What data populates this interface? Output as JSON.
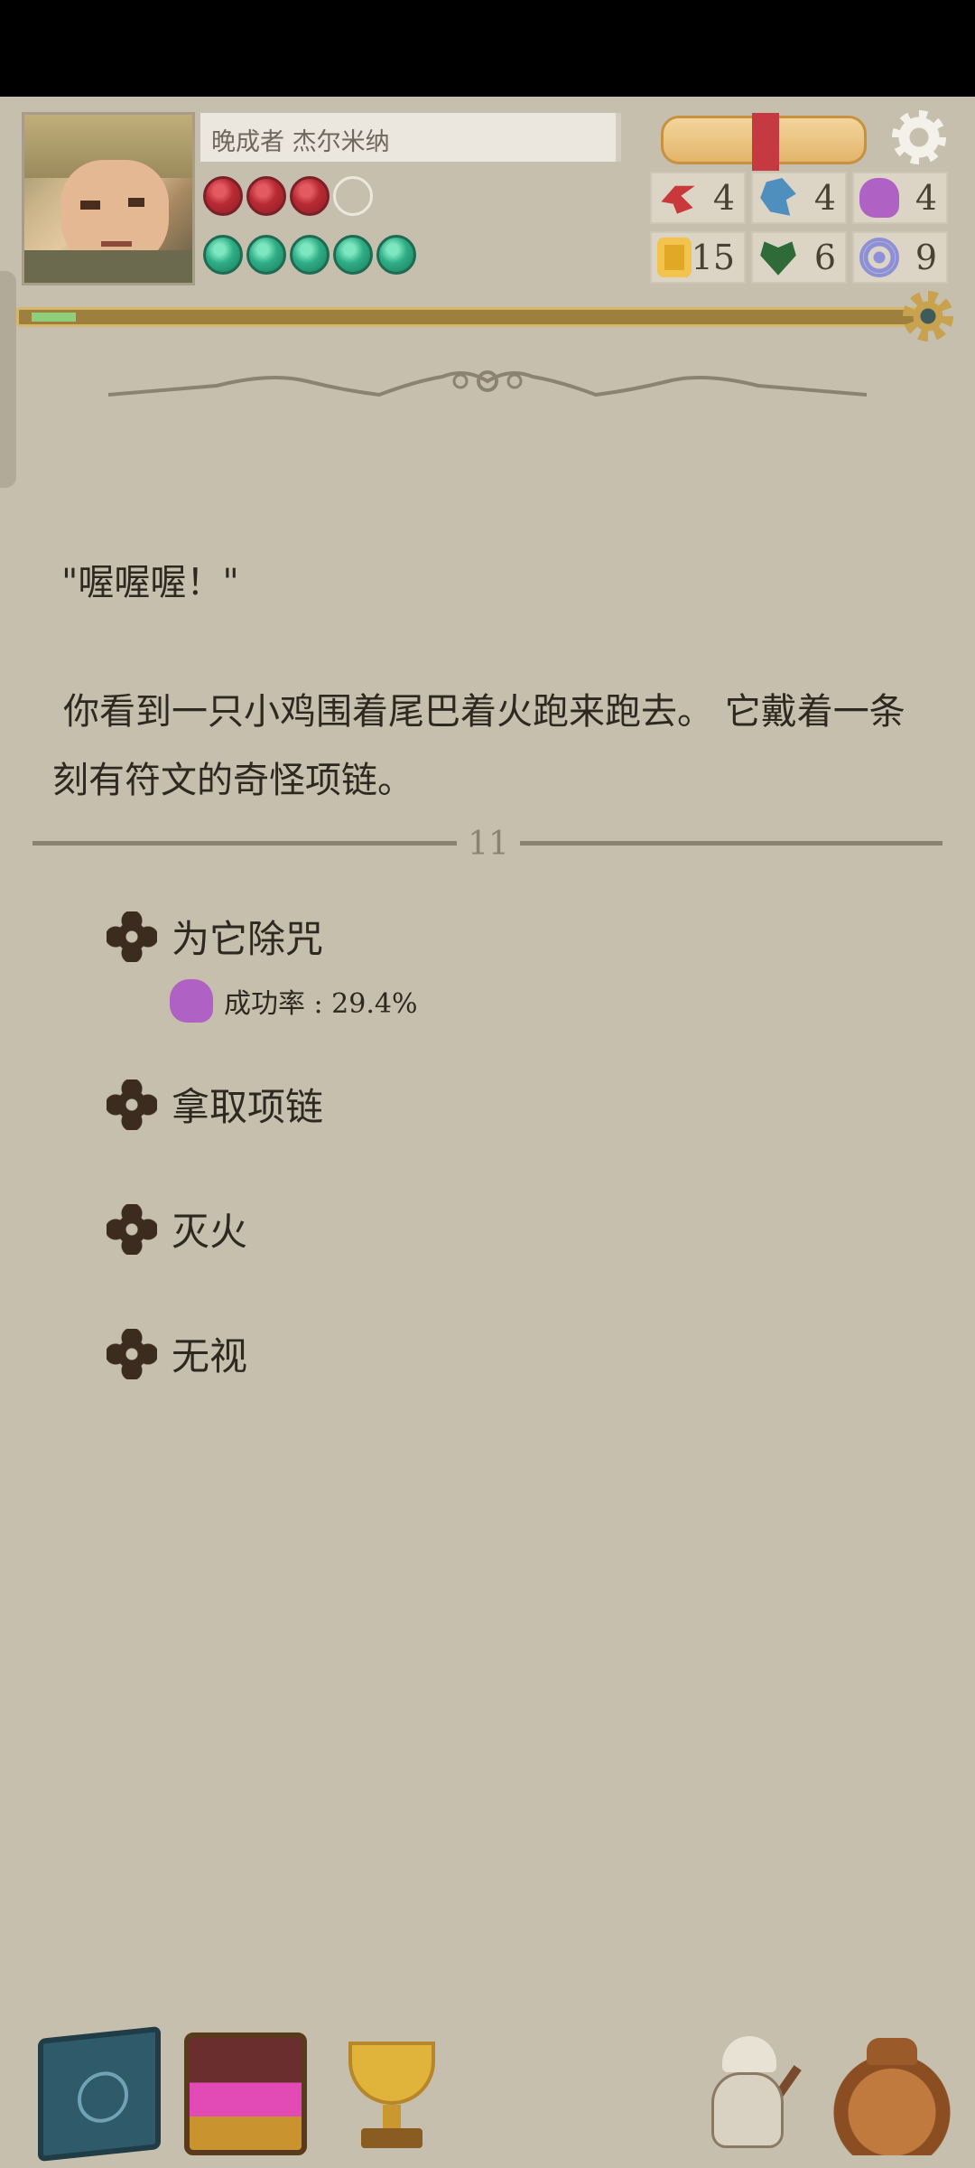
{
  "header": {
    "character_name": "晚成者 杰尔米纳",
    "health": {
      "current": 3,
      "max": 4
    },
    "mana": {
      "current": 5,
      "max": 5
    },
    "xp_progress": 0.05
  },
  "stats": [
    {
      "name": "strength",
      "icon": "fist-icon",
      "value": "4",
      "color": "#c9393c"
    },
    {
      "name": "agility",
      "icon": "boot-icon",
      "value": "4",
      "color": "#4f8fbd"
    },
    {
      "name": "intelligence",
      "icon": "brain-icon",
      "value": "4",
      "color": "#b061c4"
    },
    {
      "name": "gold",
      "icon": "coin-icon",
      "value": "15",
      "color": "#e0a825"
    },
    {
      "name": "life",
      "icon": "heart-icon",
      "value": "6",
      "color": "#2f6b38"
    },
    {
      "name": "armor",
      "icon": "target-icon",
      "value": "9",
      "color": "#8d90d6"
    }
  ],
  "event": {
    "quote": "\"喔喔喔！\"",
    "description": "你看到一只小鸡围着尾巴着火跑来跑去。 它戴着一条刻有符文的奇怪项链。",
    "turn": "11"
  },
  "choices": [
    {
      "label": "为它除咒",
      "success_rate": "成功率 : 29.4%"
    },
    {
      "label": "拿取项链"
    },
    {
      "label": "灭火"
    },
    {
      "label": "无视"
    }
  ],
  "bottom_nav": [
    "book-icon",
    "treasure-chest-icon",
    "trophy-icon",
    "chef-icon",
    "bag-icon"
  ]
}
